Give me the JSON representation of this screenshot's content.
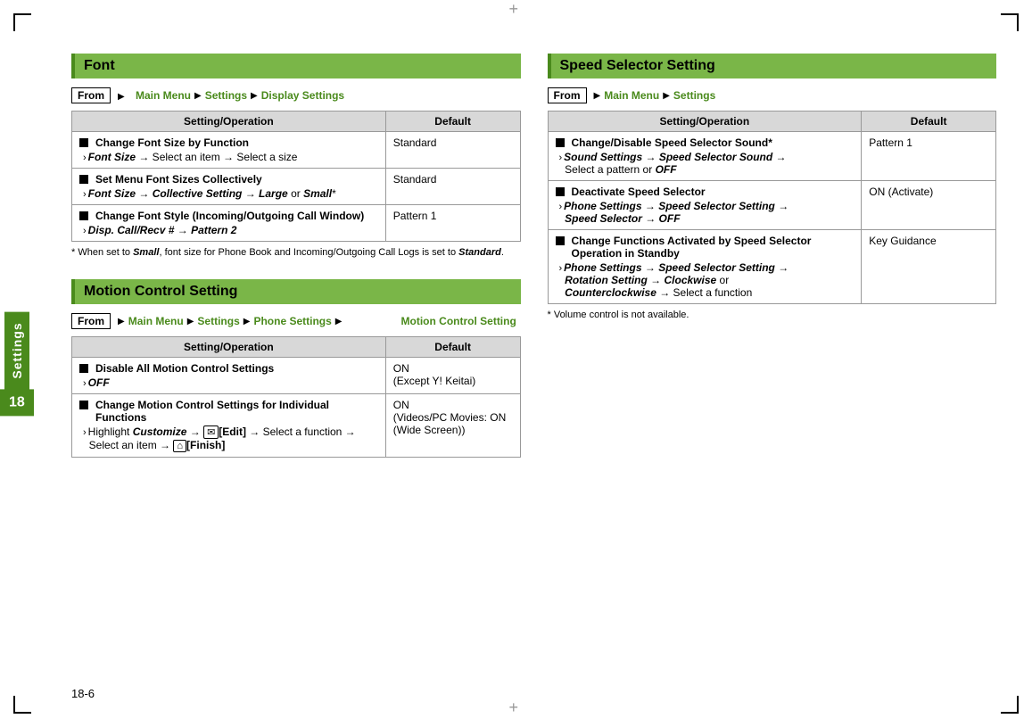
{
  "page": {
    "footer": "18-6",
    "sidetab_label": "Settings",
    "page_number": "18"
  },
  "font_section": {
    "title": "Font",
    "breadcrumb": {
      "from": "From",
      "parts": [
        "Main Menu",
        "Settings",
        "Display Settings"
      ]
    },
    "table": {
      "col1_header": "Setting/Operation",
      "col2_header": "Default",
      "rows": [
        {
          "heading": "Change Font Size by Function",
          "sub": "Font Size → Select an item → Select a size",
          "default": "Standard"
        },
        {
          "heading": "Set Menu Font Sizes Collectively",
          "sub": "Font Size → Collective Setting → Large or Small*",
          "default": "Standard"
        },
        {
          "heading": "Change Font Style (Incoming/Outgoing Call Window)",
          "sub": "Disp. Call/Recv # → Pattern 2",
          "default": "Pattern 1"
        }
      ]
    },
    "footnote": "* When set to Small, font size for Phone Book and Incoming/Outgoing Call Logs is set to Standard."
  },
  "motion_section": {
    "title": "Motion Control Setting",
    "breadcrumb": {
      "from": "From",
      "parts": [
        "Main Menu",
        "Settings",
        "Phone Settings",
        "Motion Control Setting"
      ]
    },
    "table": {
      "col1_header": "Setting/Operation",
      "col2_header": "Default",
      "rows": [
        {
          "heading": "Disable All Motion Control Settings",
          "sub": "OFF",
          "default": "ON\n(Except Y! Keitai)"
        },
        {
          "heading": "Change Motion Control Settings for Individual Functions",
          "sub": "Highlight Customize → [Edit] → Select a function → Select an item → [Finish]",
          "default": "ON\n(Videos/PC Movies: ON\n(Wide Screen))"
        }
      ]
    }
  },
  "speed_section": {
    "title": "Speed Selector Setting",
    "breadcrumb": {
      "from": "From",
      "parts": [
        "Main Menu",
        "Settings"
      ]
    },
    "table": {
      "col1_header": "Setting/Operation",
      "col2_header": "Default",
      "rows": [
        {
          "heading": "Change/Disable Speed Selector Sound*",
          "sub": "Sound Settings → Speed Selector Sound → Select a pattern or OFF",
          "default": "Pattern 1"
        },
        {
          "heading": "Deactivate Speed Selector",
          "sub": "Phone Settings → Speed Selector Setting → Speed Selector → OFF",
          "default": "ON (Activate)"
        },
        {
          "heading": "Change Functions Activated by Speed Selector Operation in Standby",
          "sub": "Phone Settings → Speed Selector Setting → Rotation Setting → Clockwise or Counterclockwise → Select a function",
          "default": "Key Guidance"
        }
      ]
    },
    "footnote": "* Volume control is not available."
  }
}
